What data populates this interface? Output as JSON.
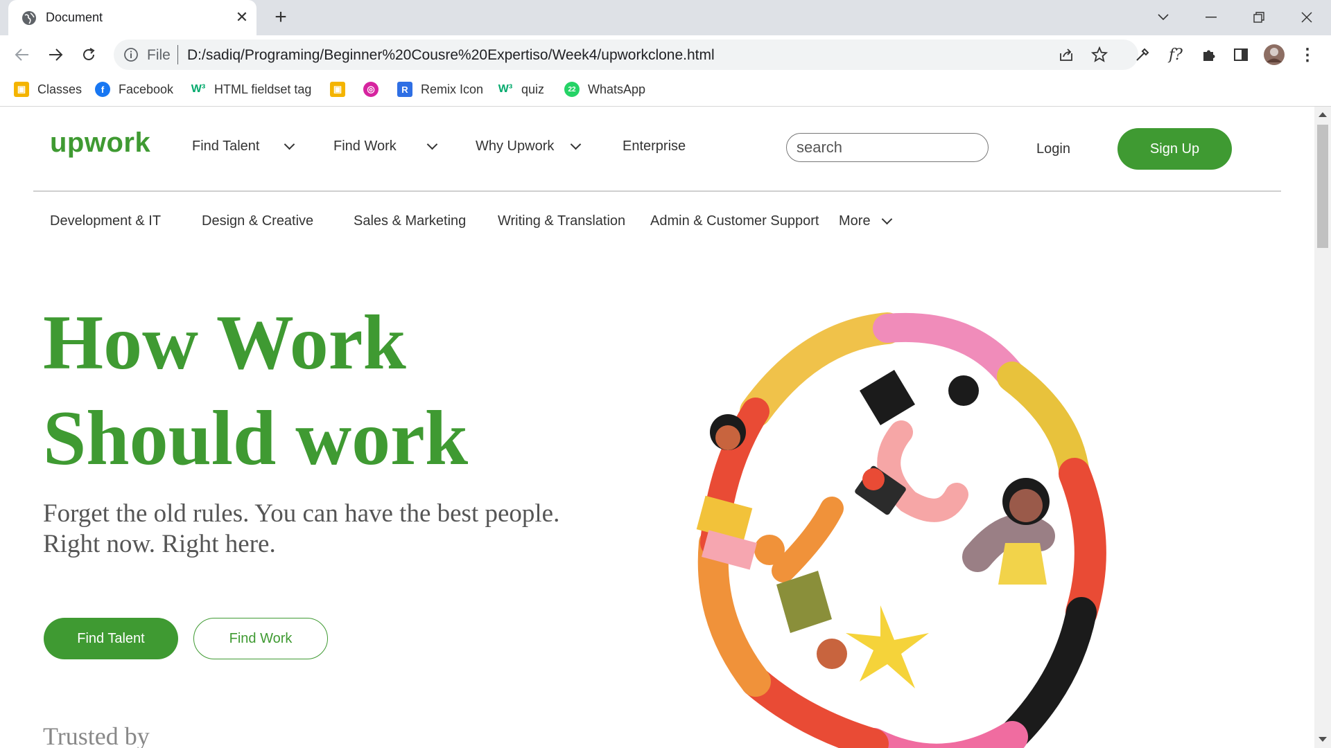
{
  "browser": {
    "tab_title": "Document",
    "url_scheme": "File",
    "url": "D:/sadiq/Programing/Beginner%20Cousre%20Expertiso/Week4/upworkclone.html"
  },
  "bookmarks": [
    {
      "label": "Classes",
      "icon": "classroom-icon"
    },
    {
      "label": "Facebook",
      "icon": "facebook-icon"
    },
    {
      "label": "HTML fieldset tag",
      "icon": "w3schools-icon"
    },
    {
      "label": "",
      "icon": "classroom-icon"
    },
    {
      "label": "",
      "icon": "instagram-icon"
    },
    {
      "label": "Remix Icon",
      "icon": "remix-icon"
    },
    {
      "label": "quiz",
      "icon": "w3schools-icon"
    },
    {
      "label": "WhatsApp",
      "icon": "whatsapp-icon",
      "badge": "22"
    }
  ],
  "site": {
    "logo": "upwork",
    "nav": [
      "Find Talent",
      "Find Work",
      "Why Upwork",
      "Enterprise"
    ],
    "search_placeholder": "search",
    "login": "Login",
    "signup": "Sign Up",
    "categories": [
      "Development & IT",
      "Design & Creative",
      "Sales & Marketing",
      "Writing & Translation",
      "Admin & Customer Support",
      "More"
    ]
  },
  "hero": {
    "title_line1": "How Work",
    "title_line2": "Should work",
    "subtitle_line1": "Forget the old rules. You can have the best people.",
    "subtitle_line2": "Right now. Right here.",
    "primary_button": "Find Talent",
    "secondary_button": "Find Work",
    "trusted": "Trusted by"
  },
  "colors": {
    "brand_green": "#3f9a32"
  }
}
